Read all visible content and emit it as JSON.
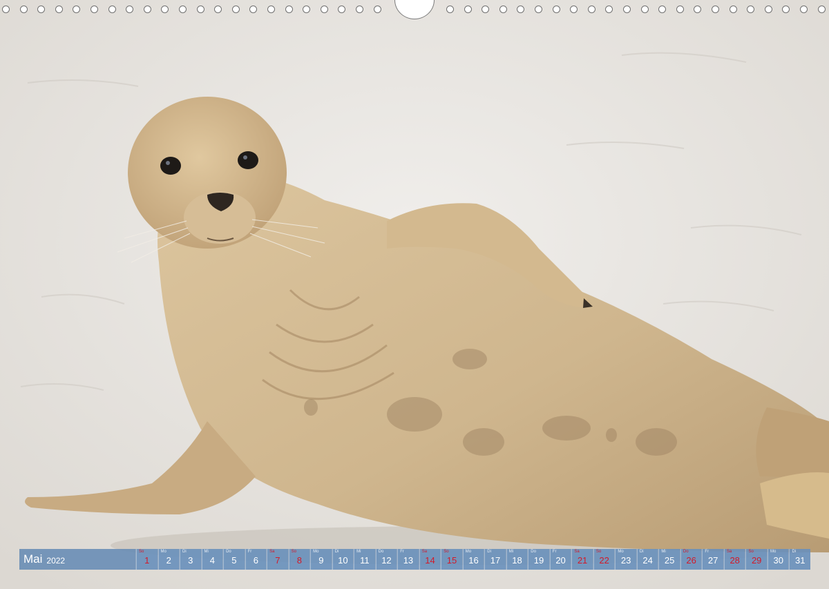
{
  "calendar": {
    "month": "Mai",
    "year": "2022",
    "weekend_color": "#d21a2a",
    "days": [
      {
        "dn": "So",
        "num": "1",
        "red": true
      },
      {
        "dn": "Mo",
        "num": "2",
        "red": false
      },
      {
        "dn": "Di",
        "num": "3",
        "red": false
      },
      {
        "dn": "Mi",
        "num": "4",
        "red": false
      },
      {
        "dn": "Do",
        "num": "5",
        "red": false
      },
      {
        "dn": "Fr",
        "num": "6",
        "red": false
      },
      {
        "dn": "Sa",
        "num": "7",
        "red": true
      },
      {
        "dn": "So",
        "num": "8",
        "red": true
      },
      {
        "dn": "Mo",
        "num": "9",
        "red": false
      },
      {
        "dn": "Di",
        "num": "10",
        "red": false
      },
      {
        "dn": "Mi",
        "num": "11",
        "red": false
      },
      {
        "dn": "Do",
        "num": "12",
        "red": false
      },
      {
        "dn": "Fr",
        "num": "13",
        "red": false
      },
      {
        "dn": "Sa",
        "num": "14",
        "red": true
      },
      {
        "dn": "So",
        "num": "15",
        "red": true
      },
      {
        "dn": "Mo",
        "num": "16",
        "red": false
      },
      {
        "dn": "Di",
        "num": "17",
        "red": false
      },
      {
        "dn": "Mi",
        "num": "18",
        "red": false
      },
      {
        "dn": "Do",
        "num": "19",
        "red": false
      },
      {
        "dn": "Fr",
        "num": "20",
        "red": false
      },
      {
        "dn": "Sa",
        "num": "21",
        "red": true
      },
      {
        "dn": "So",
        "num": "22",
        "red": true
      },
      {
        "dn": "Mo",
        "num": "23",
        "red": false
      },
      {
        "dn": "Di",
        "num": "24",
        "red": false
      },
      {
        "dn": "Mi",
        "num": "25",
        "red": false
      },
      {
        "dn": "Do",
        "num": "26",
        "red": true
      },
      {
        "dn": "Fr",
        "num": "27",
        "red": false
      },
      {
        "dn": "Sa",
        "num": "28",
        "red": true
      },
      {
        "dn": "So",
        "num": "29",
        "red": true
      },
      {
        "dn": "Mo",
        "num": "30",
        "red": false
      },
      {
        "dn": "Di",
        "num": "31",
        "red": false
      }
    ]
  },
  "photo": {
    "subject": "seal-on-sand",
    "sand_color": "#e6e3df",
    "seal_color": "#d2b990"
  }
}
